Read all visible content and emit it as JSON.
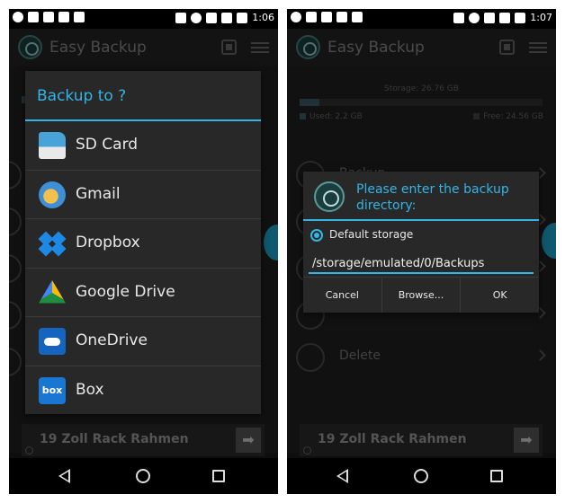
{
  "left": {
    "status_time": "1:06",
    "app_title": "Easy Backup",
    "dialog": {
      "title": "Backup to ?",
      "options": [
        {
          "label": "SD Card",
          "icon": "sd-card-icon"
        },
        {
          "label": "Gmail",
          "icon": "gmail-icon"
        },
        {
          "label": "Dropbox",
          "icon": "dropbox-icon"
        },
        {
          "label": "Google Drive",
          "icon": "google-drive-icon"
        },
        {
          "label": "OneDrive",
          "icon": "onedrive-icon"
        },
        {
          "label": "Box",
          "icon": "box-icon",
          "icon_text": "box"
        }
      ]
    },
    "ad_text": "19 Zoll Rack Rahmen",
    "ad_arrow": "➡"
  },
  "right": {
    "status_time": "1:07",
    "app_title": "Easy Backup",
    "storage": {
      "total_label": "Storage: 26.76 GB",
      "used_label": "Used: 2.2 GB",
      "free_label": "Free: 24.56 GB",
      "used_fraction": 0.082
    },
    "menu": {
      "backup_label": "Backup",
      "delete_label": "Delete"
    },
    "dialog": {
      "title": "Please enter the backup directory:",
      "radio_label": "Default storage",
      "directory_value": "/storage/emulated/0/Backups",
      "cancel_label": "Cancel",
      "browse_label": "Browse...",
      "ok_label": "OK"
    },
    "ad_text": "19 Zoll Rack Rahmen",
    "ad_arrow": "➡"
  },
  "colors": {
    "accent": "#33b5e5",
    "dialog_bg": "#282828",
    "screen_bg": "#1f1f1f"
  }
}
